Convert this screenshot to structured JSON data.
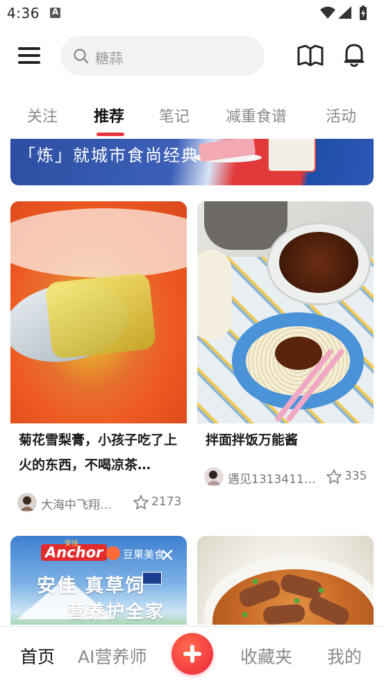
{
  "status_bar": {
    "time": "4:36"
  },
  "header": {
    "search_placeholder": "糖蒜",
    "icons": [
      "menu-icon",
      "search-icon",
      "book-icon",
      "bell-icon"
    ]
  },
  "tabs": [
    {
      "label": "关注",
      "active": false
    },
    {
      "label": "推荐",
      "active": true
    },
    {
      "label": "笔记",
      "active": false
    },
    {
      "label": "减重食谱",
      "active": false
    },
    {
      "label": "活动",
      "active": false
    }
  ],
  "banner": {
    "text": "「炼」就城市食尚经典"
  },
  "cards": [
    {
      "title": "菊花雪梨膏，小孩子吃了上火的东西，不喝凉茶…",
      "author": "大海中飞翔…",
      "likes": "2173"
    },
    {
      "title": "拌面拌饭万能酱",
      "author": "遇见1313411…",
      "likes": "335"
    }
  ],
  "ad": {
    "brand": "Anchor",
    "brand_cn": "安佳",
    "partner": "豆果美食",
    "line1": "安佳 真草饲",
    "line2": "营养护全家"
  },
  "bottom_nav": {
    "home": "首页",
    "ai": "AI营养师",
    "favorites": "收藏夹",
    "mine": "我的"
  },
  "colors": {
    "accent": "#e8323c",
    "add_button": "#f0253a"
  }
}
